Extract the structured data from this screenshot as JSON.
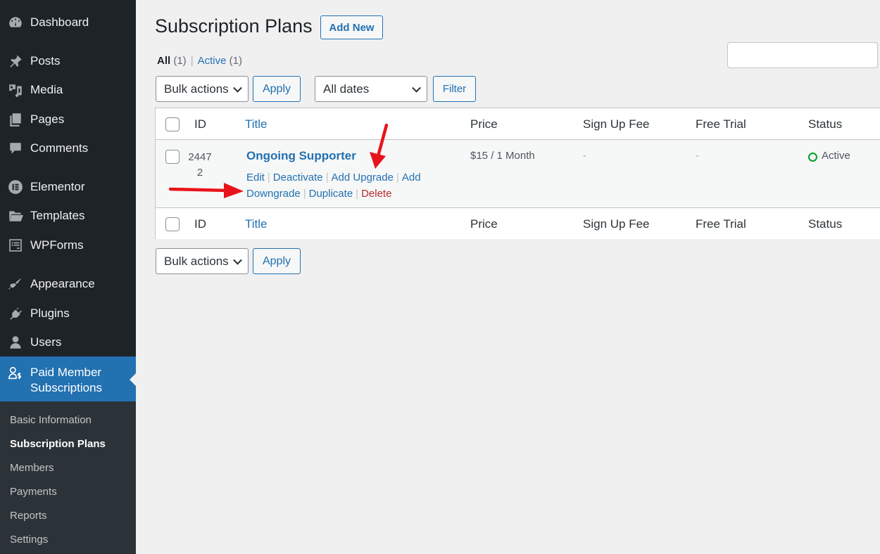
{
  "sidebar": {
    "items": [
      {
        "label": "Dashboard",
        "icon": "dashboard-icon"
      },
      {
        "label": "Posts",
        "icon": "pushpin-icon"
      },
      {
        "label": "Media",
        "icon": "media-icon"
      },
      {
        "label": "Pages",
        "icon": "pages-icon"
      },
      {
        "label": "Comments",
        "icon": "comment-icon"
      },
      {
        "label": "Elementor",
        "icon": "elementor-icon"
      },
      {
        "label": "Templates",
        "icon": "folder-icon"
      },
      {
        "label": "WPForms",
        "icon": "form-icon"
      },
      {
        "label": "Appearance",
        "icon": "paintbrush-icon"
      },
      {
        "label": "Plugins",
        "icon": "plug-icon"
      },
      {
        "label": "Users",
        "icon": "user-icon"
      },
      {
        "label": "Paid Member Subscriptions",
        "icon": "member-dollar-icon",
        "active": true
      }
    ],
    "submenu": [
      {
        "label": "Basic Information"
      },
      {
        "label": "Subscription Plans",
        "current": true
      },
      {
        "label": "Members"
      },
      {
        "label": "Payments"
      },
      {
        "label": "Reports"
      },
      {
        "label": "Settings"
      }
    ]
  },
  "header": {
    "title": "Subscription Plans",
    "add_new_label": "Add New"
  },
  "views": {
    "all_label": "All",
    "all_count": "(1)",
    "separator": "|",
    "active_label": "Active",
    "active_count": "(1)"
  },
  "search": {
    "value": ""
  },
  "toolbar_top": {
    "bulk_actions": "Bulk actions",
    "apply_label": "Apply",
    "dates_selected": "All dates",
    "filter_label": "Filter"
  },
  "toolbar_bottom": {
    "bulk_actions": "Bulk actions",
    "apply_label": "Apply"
  },
  "table": {
    "columns": [
      "ID",
      "Title",
      "Price",
      "Sign Up Fee",
      "Free Trial",
      "Status"
    ],
    "rows": [
      {
        "id_line1": "2447",
        "id_line2": "2",
        "title": "Ongoing Supporter",
        "price": "$15 / 1 Month",
        "sign_up_fee": "-",
        "free_trial": "-",
        "status": "Active",
        "actions": {
          "edit": "Edit",
          "deactivate": "Deactivate",
          "add_upgrade": "Add Upgrade",
          "add_downgrade": "Add Downgrade",
          "duplicate": "Duplicate",
          "delete": "Delete",
          "separator": "|"
        }
      }
    ]
  },
  "colors": {
    "accent": "#2271b1",
    "sidebar_bg": "#1d2327",
    "submenu_bg": "#2c3338",
    "status_active": "#00a32a",
    "delete": "#b32d2e",
    "annotation_arrow": "#e8141b"
  }
}
